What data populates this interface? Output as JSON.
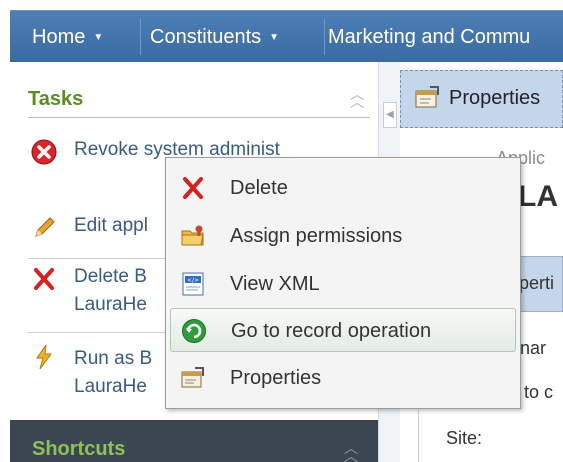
{
  "nav": {
    "items": [
      {
        "label": "Home",
        "caret": "▼"
      },
      {
        "label": "Constituents",
        "caret": "▼"
      },
      {
        "label": "Marketing and Commu",
        "caret": ""
      }
    ]
  },
  "tasks": {
    "title": "Tasks",
    "items": [
      {
        "label": "Revoke system administ",
        "icon": "revoke-icon"
      },
      {
        "label": "Edit appl",
        "icon": "pencil-icon"
      },
      {
        "label": "Delete B LauraHe",
        "icon": "delete-icon"
      },
      {
        "label": "Run as B LauraHe",
        "icon": "lightning-icon"
      }
    ]
  },
  "shortcuts": {
    "title": "Shortcuts"
  },
  "right": {
    "properties_label": "Properties",
    "app_sub": "Applic",
    "app_title": "LA",
    "properties2_label": "perti",
    "name_label": "nar",
    "to_label": "to c",
    "site_label": "Site:"
  },
  "context_menu": {
    "items": [
      {
        "label": "Delete",
        "icon": "delete-icon"
      },
      {
        "label": "Assign permissions",
        "icon": "folder-permissions-icon"
      },
      {
        "label": "View XML",
        "icon": "xml-document-icon"
      },
      {
        "label": "Go to record operation",
        "icon": "go-to-record-icon",
        "hover": true
      },
      {
        "label": "Properties",
        "icon": "properties-icon"
      }
    ]
  },
  "colors": {
    "nav_bg": "#3f6fa8",
    "tasks_title": "#5a8e1e",
    "link": "#3a5b86",
    "shortcuts_bg": "#3c4652",
    "menu_hover": "#e4ebe4"
  }
}
